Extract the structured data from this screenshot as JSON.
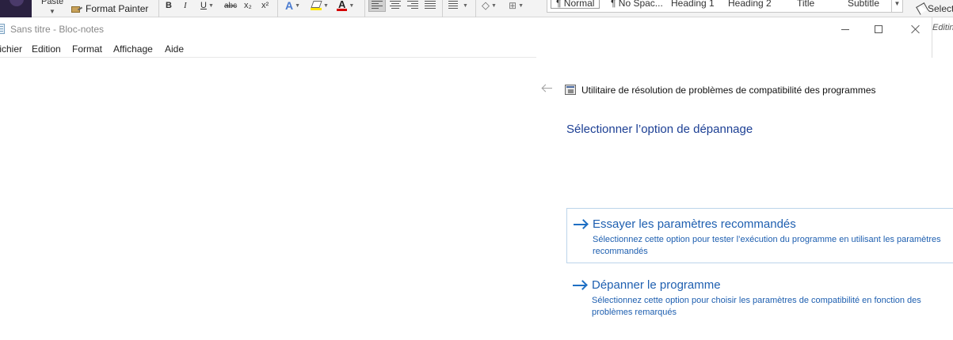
{
  "ribbon": {
    "paste_label": "Paste",
    "format_painter_label": "Format Painter",
    "bold_label": "B",
    "italic_label": "I",
    "underline_label": "U",
    "strikethrough_label": "abc",
    "subscript_label": "x₂",
    "superscript_label": "x²",
    "text_effects_label": "A",
    "font_color_label": "A",
    "styles": [
      "¶ Normal",
      "¶ No Spac...",
      "Heading 1",
      "Heading 2",
      "Title",
      "Subtitle"
    ],
    "select_label": "Select",
    "editing_label": "Editing",
    "colors": {
      "highlight": "#ffe600",
      "font_color": "#d40000"
    }
  },
  "notepad": {
    "title": "Sans titre - Bloc-notes",
    "menu": [
      "Fichier",
      "Edition",
      "Format",
      "Affichage",
      "Aide"
    ],
    "content": ""
  },
  "troubleshooter": {
    "title": "Utilitaire de résolution de problèmes de compatibilité des programmes",
    "heading": "Sélectionner l’option de dépannage",
    "options": [
      {
        "title": "Essayer les paramètres recommandés",
        "description": "Sélectionnez cette option pour tester l’exécution du programme en utilisant les paramètres recommandés"
      },
      {
        "title": "Dépanner le programme",
        "description": "Sélectionnez cette option pour choisir les paramètres de compatibilité en fonction des problèmes remarqués"
      }
    ],
    "colors": {
      "heading": "#1c3f94",
      "link": "#1e5fb0",
      "option_border": "#bcd4ea"
    }
  }
}
